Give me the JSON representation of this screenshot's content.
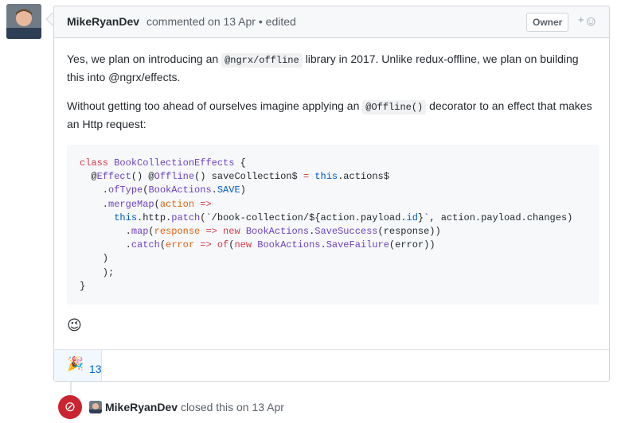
{
  "comment": {
    "author": "MikeRyanDev",
    "meta": "commented on 13 Apr • edited",
    "badge": "Owner",
    "add_reaction_plus": "+",
    "add_reaction_icon": "smiley-icon",
    "paragraph1_before": "Yes, we plan on introducing an ",
    "paragraph1_code": "@ngrx/offline",
    "paragraph1_after": " library in 2017. Unlike redux-offline, we plan on building this into @ngrx/effects.",
    "paragraph2_before": "Without getting too ahead of ourselves imagine applying an ",
    "paragraph2_code": "@Offline()",
    "paragraph2_after": " decorator to an effect that makes an Http request:",
    "code_lines": [
      "class BookCollectionEffects {",
      "  @Effect() @Offline() saveCollection$ = this.actions$",
      "    .ofType(BookActions.SAVE)",
      "    .mergeMap(action =>",
      "      this.http.patch(`/book-collection/${action.payload.id}`, action.payload.changes)",
      "        .map(response => new BookActions.SaveSuccess(response))",
      "        .catch(error => of(new BookActions.SaveFailure(error))",
      "    )",
      "    );",
      "}"
    ],
    "closing_emoji": "😉",
    "reactions": [
      {
        "emoji": "🎉",
        "count": "13"
      }
    ]
  },
  "event": {
    "icon": "circle-slash-icon",
    "actor": "MikeRyanDev",
    "text": "closed this on 13 Apr"
  },
  "colors": {
    "closed_red": "#cb2431",
    "link_blue": "#0366d6",
    "header_bg": "#f6f8fa"
  }
}
